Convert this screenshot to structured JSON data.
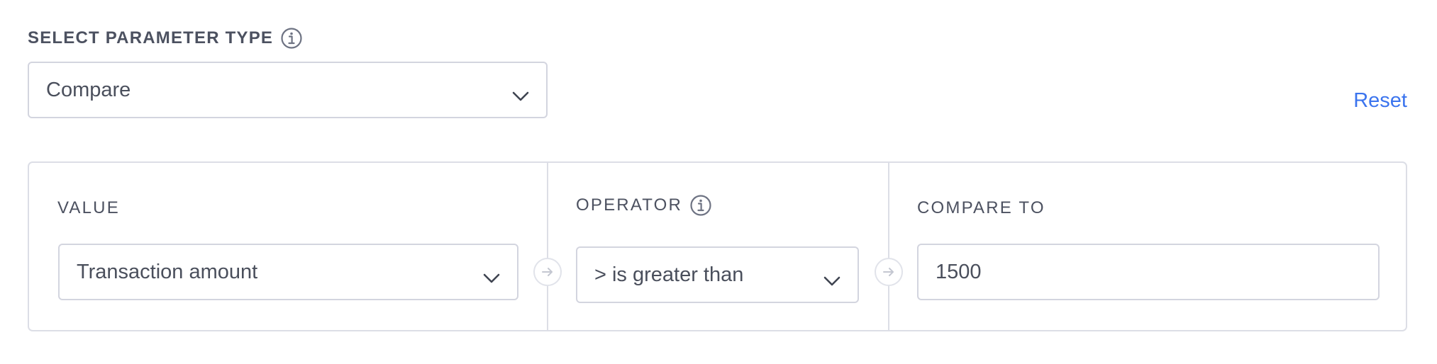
{
  "param_type": {
    "label": "SELECT PARAMETER TYPE",
    "selected": "Compare",
    "info_icon": "info-icon"
  },
  "reset_label": "Reset",
  "condition": {
    "value": {
      "label": "VALUE",
      "selected": "Transaction amount"
    },
    "operator": {
      "label": "OPERATOR",
      "selected": "> is greater than",
      "info_icon": "info-icon"
    },
    "compare_to": {
      "label": "COMPARE TO",
      "value": "1500"
    },
    "connector_icon": "arrow-right-icon"
  },
  "colors": {
    "accent": "#3b74ee",
    "border": "#d3d5df",
    "text": "#4a4f5c",
    "icon": "#6e7383"
  }
}
